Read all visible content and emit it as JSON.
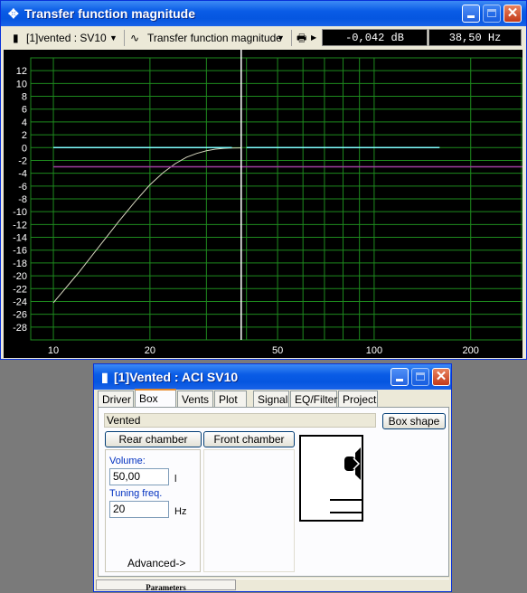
{
  "main_window": {
    "title": "Transfer function magnitude",
    "driver_select": "[1]vented : SV10",
    "plot_select": "Transfer function magnitude",
    "readout_db": "-0,042 dB",
    "readout_freq": "38,50 Hz"
  },
  "chart_data": {
    "type": "line",
    "xscale": "log",
    "xlim": [
      8.5,
      290
    ],
    "ylim": [
      -30,
      14
    ],
    "x_tick_labels": [
      "10",
      "20",
      "50",
      "100",
      "200"
    ],
    "y_tick_labels": [
      "12",
      "10",
      "8",
      "6",
      "4",
      "2",
      "0",
      "-2",
      "-4",
      "-6",
      "-8",
      "-10",
      "-12",
      "-14",
      "-16",
      "-18",
      "-20",
      "-22",
      "-24",
      "-26",
      "-28"
    ],
    "grid": true,
    "cursor_x": 38.5,
    "colors": {
      "background": "#000000",
      "grid": "#1e8a1e",
      "curve": "#d8d8c0",
      "flat_line": "#80ffff",
      "reference_line": "#a040a0",
      "cursor": "#ffffff"
    },
    "series": [
      {
        "color": "#d8d8c0",
        "x": [
          10,
          12,
          14,
          16,
          18,
          20,
          22,
          24,
          26,
          28,
          30,
          32,
          34,
          36,
          38.5
        ],
        "y": [
          -24.2,
          -19.5,
          -15.2,
          -11.5,
          -8.4,
          -5.8,
          -3.9,
          -2.5,
          -1.5,
          -0.9,
          -0.5,
          -0.25,
          -0.12,
          -0.06,
          -0.04
        ]
      },
      {
        "color": "#80ffff",
        "x": [
          10,
          36
        ],
        "y": [
          0,
          0
        ]
      },
      {
        "color": "#80ffff",
        "x": [
          40,
          160
        ],
        "y": [
          0,
          0
        ]
      },
      {
        "color": "#a040a0",
        "x": [
          10,
          290
        ],
        "y": [
          -3,
          -3
        ]
      }
    ]
  },
  "box_window": {
    "title": "[1]Vented : ACI SV10",
    "tabs": [
      "Driver",
      "Box",
      "Vents",
      "Plot",
      "Signal",
      "EQ/Filter",
      "Project"
    ],
    "active_tab": "Box",
    "box_type": "Vented",
    "box_shape_button": "Box shape",
    "rear_chamber_button": "Rear chamber",
    "front_chamber_button": "Front chamber",
    "volume_label": "Volume:",
    "volume_value": "50,00",
    "volume_unit": "l",
    "tuning_label": "Tuning freq.",
    "tuning_value": "20",
    "tuning_unit": "Hz",
    "advanced_button": "Advanced->",
    "status_tab": "Parameters"
  }
}
